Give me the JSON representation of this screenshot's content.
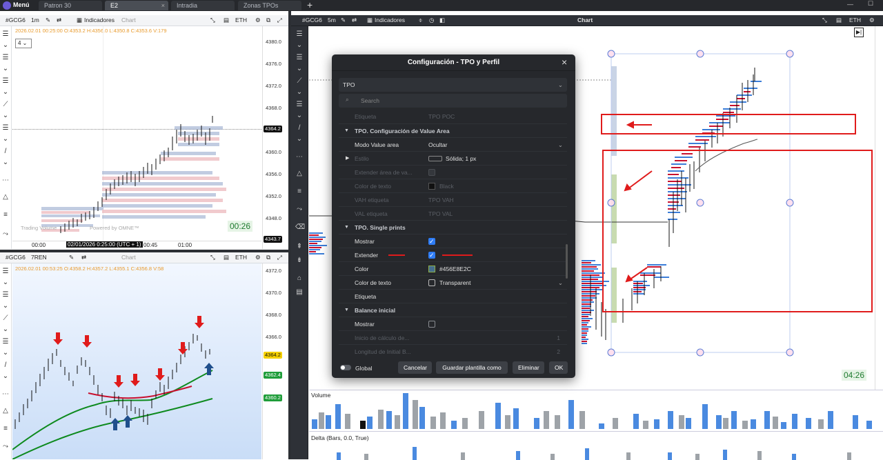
{
  "tabbar": {
    "menu_label": "Menú",
    "tabs": [
      {
        "label": "Patron 30"
      },
      {
        "label": "E2"
      },
      {
        "label": "Intradia"
      },
      {
        "label": "Zonas TPOs"
      }
    ],
    "add_label": "+",
    "close_label": "×"
  },
  "panel1": {
    "symbol": "#GCG6",
    "timeframe": "1m",
    "indicators_label": "Indicadores",
    "title": "Chart",
    "session": "ETH",
    "ohlc": "2026.02.01 00:25:00 O:4353.2 H:4356.0 L:4350.8 C:4353.6 V:179",
    "dropdown_value": "4",
    "prices": [
      "4380.0",
      "4376.0",
      "4372.0",
      "4368.0",
      "4364.2",
      "4360.0",
      "4356.0",
      "4352.0",
      "4348.0",
      "4343.7"
    ],
    "current_price": "4364.2",
    "low_price": "4343.7",
    "time_labels": [
      "00:00",
      "00:45",
      "01:00"
    ],
    "time_cursor": "02/01/2026 0:25:00 (UTC + 1)",
    "countdown": "00:26",
    "watermark": "Trading Volume",
    "powered": "Powered by OMNE™"
  },
  "panel2": {
    "symbol": "#GCG6",
    "timeframe": "7REN",
    "title": "Chart",
    "session": "ETH",
    "ohlc": "2026.02.01 00:53:25 O:4358.2 H:4357.2 L:4355.1 C:4356.8 V:58",
    "prices": [
      "4372.0",
      "4370.0",
      "4368.0",
      "4366.0",
      "4364.2",
      "4362.4",
      "4360.2"
    ],
    "tag_current": "4364.2",
    "tag_green1": "4362.4",
    "tag_green2": "4360.2"
  },
  "panel3": {
    "symbol": "#GCG6",
    "timeframe": "5m",
    "indicators_label": "Indicadores",
    "title": "Chart",
    "session": "ETH",
    "countdown": "04:26",
    "volume_label": "Volume",
    "delta_label": "Delta (Bars, 0.0, True)"
  },
  "dialog": {
    "title": "Configuración - TPO y Perfil",
    "close": "×",
    "dropdown": "TPO",
    "search_placeholder": "Search",
    "rows": {
      "etiqueta_top": {
        "label": "Etiqueta",
        "value": "TPO POC"
      },
      "sect_value_area": "TPO. Configuración de Value Area",
      "modo": {
        "label": "Modo Value area",
        "value": "Ocultar"
      },
      "estilo": {
        "label": "Estilo",
        "value": "Sólida; 1 px"
      },
      "extender_area": {
        "label": "Extender área de va..."
      },
      "color_texto1": {
        "label": "Color de texto",
        "value": "Black"
      },
      "vah": {
        "label": "VAH etiqueta",
        "value": "TPO VAH"
      },
      "val": {
        "label": "VAL etiqueta",
        "value": "TPO VAL"
      },
      "sect_single": "TPO. Single prints",
      "mostrar": {
        "label": "Mostrar"
      },
      "extender": {
        "label": "Extender"
      },
      "color": {
        "label": "Color",
        "value": "#456E8E2C"
      },
      "color_texto2": {
        "label": "Color de texto",
        "value": "Transparent"
      },
      "etiqueta": {
        "label": "Etiqueta"
      },
      "sect_balance": "Balance inicial",
      "mostrar2": {
        "label": "Mostrar"
      },
      "inicio": {
        "label": "Inicio de cálculo de...",
        "value": "1"
      },
      "longitud": {
        "label": "Longitud de Initial B...",
        "value": "2"
      }
    },
    "global_label": "Global",
    "buttons": {
      "cancel": "Cancelar",
      "save_template": "Guardar plantilla como",
      "delete": "Eliminar",
      "ok": "OK"
    }
  },
  "colors": {
    "accent": "#2f7df6",
    "highlight_red": "#e01b1b",
    "bull": "#3b7dd8",
    "bear": "#c8102e",
    "green_tag": "#1f9d3a"
  }
}
